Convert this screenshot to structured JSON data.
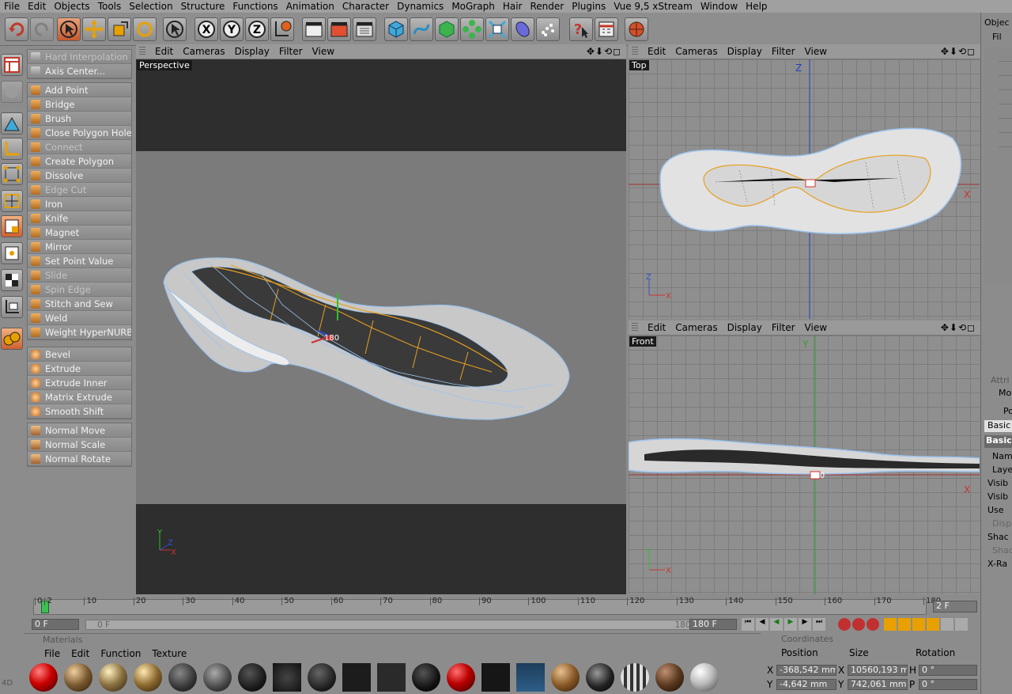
{
  "menu": [
    "File",
    "Edit",
    "Objects",
    "Tools",
    "Selection",
    "Structure",
    "Functions",
    "Animation",
    "Character",
    "Dynamics",
    "MoGraph",
    "Hair",
    "Render",
    "Plugins",
    "Vue 9,5 xStream",
    "Window",
    "Help"
  ],
  "commands_top": [
    "Hard Interpolation",
    "Axis Center..."
  ],
  "commands_main": [
    "Add Point",
    "Bridge",
    "Brush",
    "Close Polygon Hole",
    "Connect",
    "Create Polygon",
    "Dissolve",
    "Edge Cut",
    "Iron",
    "Knife",
    "Magnet",
    "Mirror",
    "Set Point Value",
    "Slide",
    "Spin Edge",
    "Stitch and Sew",
    "Weld",
    "Weight HyperNURBS"
  ],
  "commands_main_disabled": [
    false,
    false,
    false,
    false,
    true,
    false,
    false,
    true,
    false,
    false,
    false,
    false,
    false,
    true,
    true,
    false,
    false,
    false
  ],
  "commands_extrude": [
    "Bevel",
    "Extrude",
    "Extrude Inner",
    "Matrix Extrude",
    "Smooth Shift"
  ],
  "commands_normal": [
    "Normal Move",
    "Normal Scale",
    "Normal Rotate"
  ],
  "viewport_menu": [
    "Edit",
    "Cameras",
    "Display",
    "Filter",
    "View"
  ],
  "viewports": {
    "perspective": "Perspective",
    "top": "Top",
    "front": "Front"
  },
  "viewport_controls": "✥⬇⟲◻",
  "axis": {
    "x": "X",
    "y": "Y",
    "z": "Z"
  },
  "handle_label": "180",
  "timeline": {
    "ticks": [
      "0",
      "2",
      "10",
      "20",
      "30",
      "40",
      "50",
      "60",
      "70",
      "80",
      "90",
      "100",
      "110",
      "120",
      "130",
      "140",
      "150",
      "160",
      "170",
      "180"
    ],
    "current_frame": "2 F",
    "start": "0 F",
    "range_start": "0 F",
    "range_end": "180 F",
    "end": "180 F"
  },
  "materials": {
    "title": "Materials",
    "menu": [
      "File",
      "Edit",
      "Function",
      "Texture"
    ]
  },
  "coordinates": {
    "title": "Coordinates",
    "headers": [
      "Position",
      "Size",
      "Rotation"
    ],
    "rows": [
      {
        "axis": "X",
        "pos": "-368,542 mm",
        "size_axis": "X",
        "size": "10560,193 m",
        "rot_axis": "H",
        "rot": "0 °"
      },
      {
        "axis": "Y",
        "pos": "-4,642 mm",
        "size_axis": "Y",
        "size": "742,061 mm",
        "rot_axis": "P",
        "rot": "0 °"
      }
    ]
  },
  "right_panel": {
    "objects_title": "Objec",
    "fil": "Fil",
    "attr": "Attri",
    "mode": "Mo",
    "obj_label": "Po",
    "basic_tab": "Basic",
    "basic_header": "Basic",
    "props": [
      "Nam",
      "Laye",
      "Visib",
      "Visib",
      "Use",
      "Displ",
      "Shac",
      "Shac",
      "X-Ra"
    ]
  },
  "left_status": "4D"
}
